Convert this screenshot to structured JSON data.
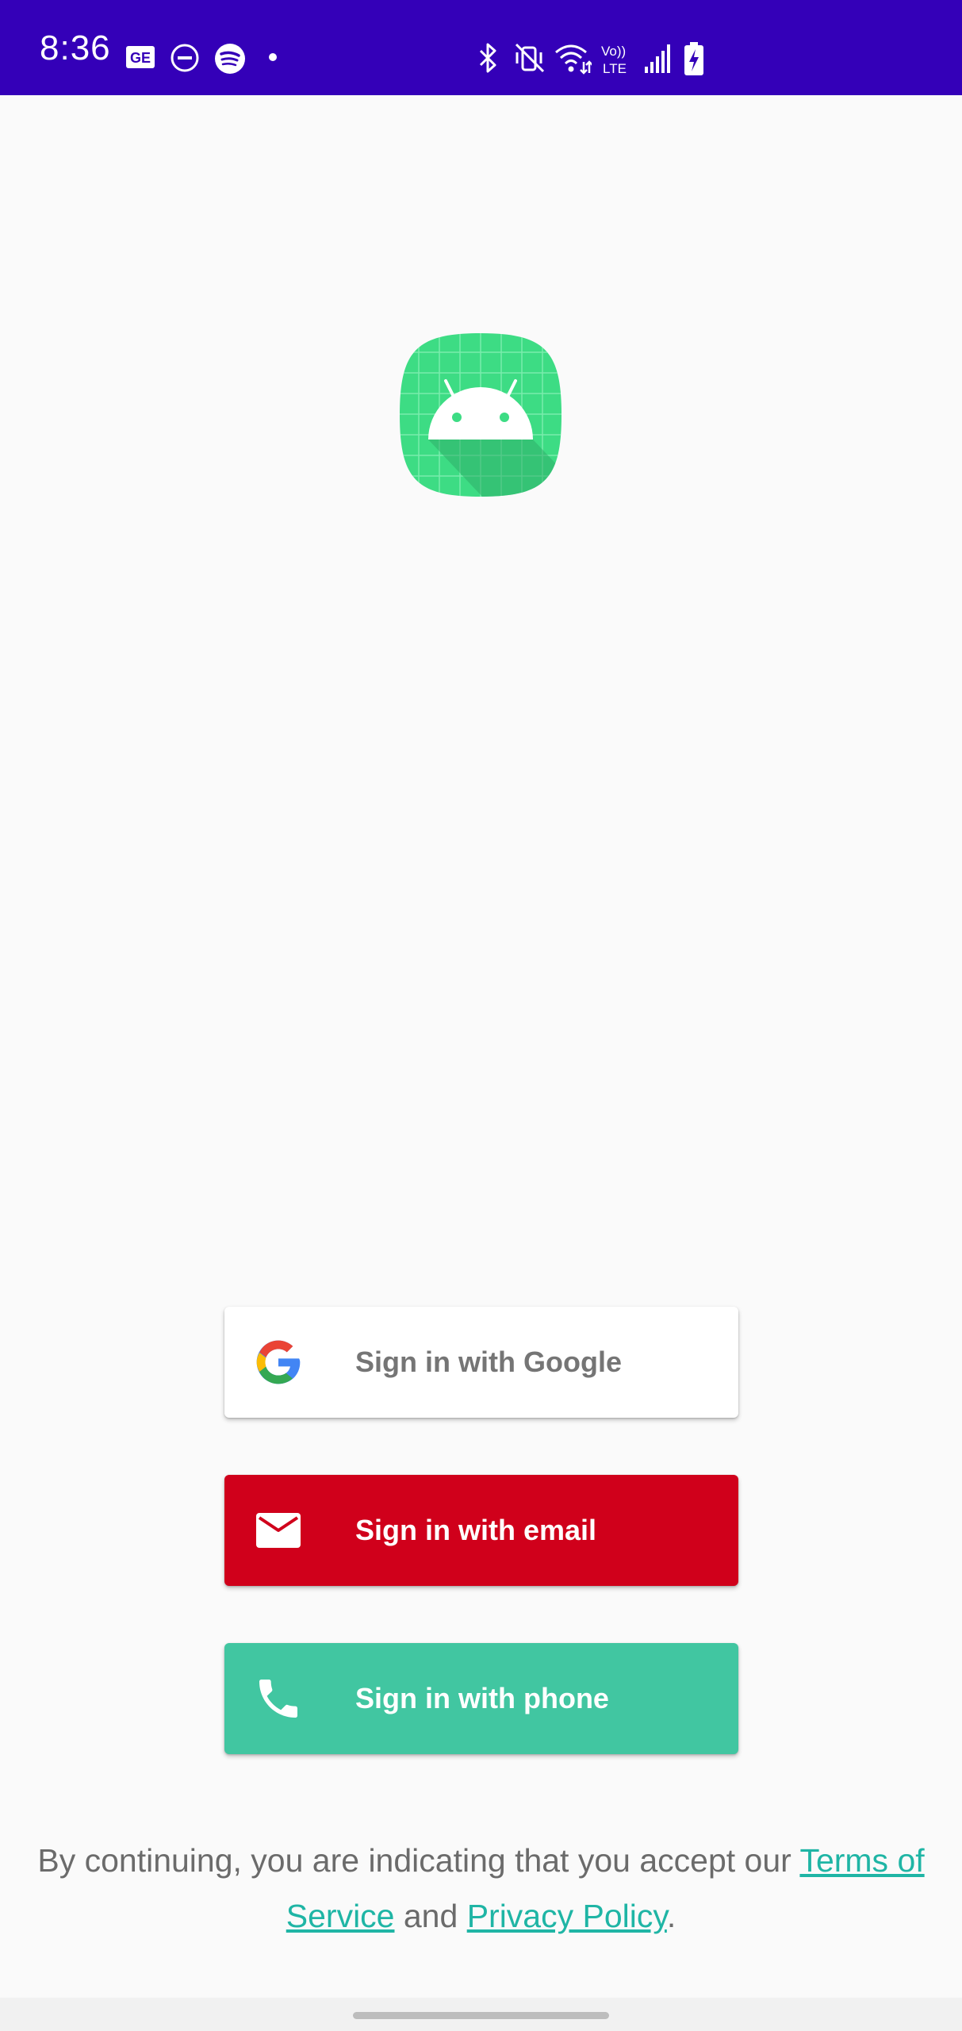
{
  "status_bar": {
    "time": "8:36",
    "background_color": "#3400b8",
    "left_icons": [
      "news-icon",
      "do-not-disturb-icon",
      "spotify-icon",
      "notification-dot-icon"
    ],
    "right_icons": [
      "bluetooth-icon",
      "vibrate-mute-icon",
      "wifi-icon",
      "volte-lte-icon",
      "cell-signal-icon",
      "battery-charging-icon"
    ],
    "volte_text_top": "Vo))",
    "volte_text_bottom": "LTE",
    "news_text": "GE"
  },
  "app_logo": {
    "icon": "android-app-logo-icon",
    "color": "#3ddc84"
  },
  "buttons": {
    "google": {
      "label": "Sign in with Google",
      "icon": "google-g-icon",
      "bg": "#ffffff"
    },
    "email": {
      "label": "Sign in with email",
      "icon": "mail-icon",
      "bg": "#d0001b"
    },
    "phone": {
      "label": "Sign in with phone",
      "icon": "phone-icon",
      "bg": "#41c6a1"
    }
  },
  "legal": {
    "prefix": "By continuing, you are indicating that you accept our ",
    "terms_link": "Terms of Service",
    "conjunction": " and ",
    "privacy_link": "Privacy Policy",
    "suffix": ".",
    "link_color": "#1fb5a5"
  }
}
